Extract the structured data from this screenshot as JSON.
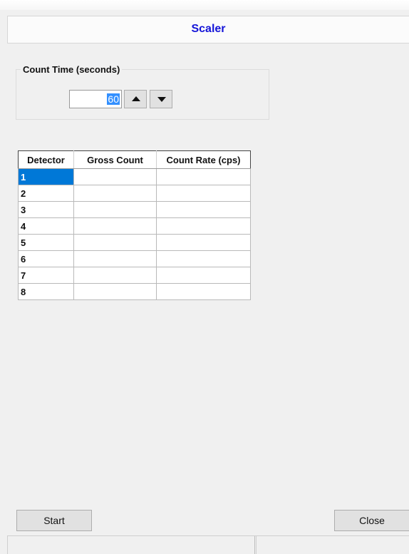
{
  "header": {
    "title": "Scaler"
  },
  "count_time": {
    "label": "Count Time (seconds)",
    "value": "60"
  },
  "table": {
    "columns": [
      "Detector",
      "Gross Count",
      "Count Rate (cps)"
    ],
    "rows": [
      {
        "detector": "1",
        "gross": "",
        "rate": ""
      },
      {
        "detector": "2",
        "gross": "",
        "rate": ""
      },
      {
        "detector": "3",
        "gross": "",
        "rate": ""
      },
      {
        "detector": "4",
        "gross": "",
        "rate": ""
      },
      {
        "detector": "5",
        "gross": "",
        "rate": ""
      },
      {
        "detector": "6",
        "gross": "",
        "rate": ""
      },
      {
        "detector": "7",
        "gross": "",
        "rate": ""
      },
      {
        "detector": "8",
        "gross": "",
        "rate": ""
      }
    ]
  },
  "buttons": {
    "start": "Start",
    "close": "Close"
  },
  "status": {
    "pane1": "",
    "pane2": ""
  }
}
